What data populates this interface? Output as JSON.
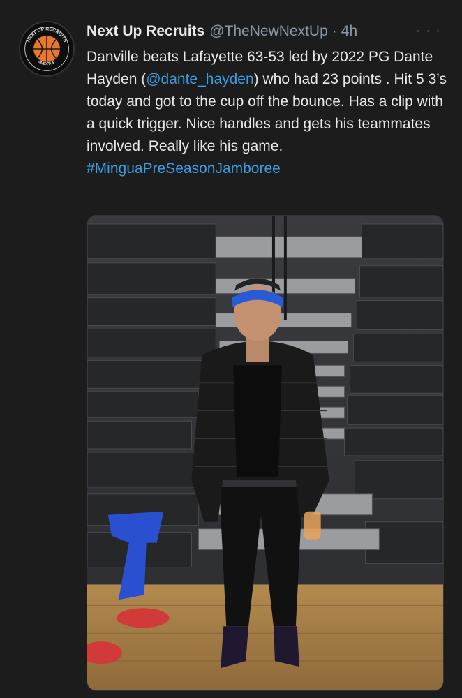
{
  "tweet": {
    "author_name": "Next Up Recruits",
    "handle": "@TheNewNextUp",
    "separator": "·",
    "time": "4h",
    "more_icon": "more-icon",
    "text_part1": "Danville beats Lafayette 63-53 led by 2022 PG Dante Hayden (",
    "mention": "@dante_hayden",
    "text_part2": ") who had 23 points . Hit 5 3’s today and got to the cup off the bounce. Has a clip with a quick trigger. Nice handles and gets his teammates involved. Really like his game.\n",
    "hashtag": "#MinguaPreSeasonJamboree",
    "avatar": {
      "icon": "basketball-logo-icon",
      "ring_text_top": "NEXT UP RECRUITS",
      "ring_text_bottom": "#NEXTUP"
    }
  },
  "colors": {
    "background": "#1c1c1c",
    "link": "#3b9de6",
    "secondary_text": "#8b98a5"
  }
}
